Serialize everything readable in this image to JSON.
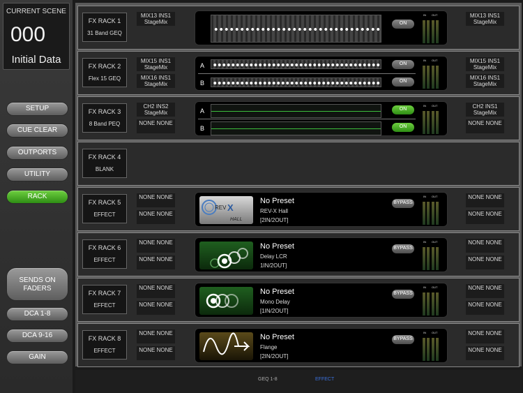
{
  "scene": {
    "label": "CURRENT SCENE",
    "number": "000",
    "name": "Initial Data"
  },
  "sidebar": {
    "setup": "SETUP",
    "cue_clear": "CUE CLEAR",
    "outports": "OUTPORTS",
    "utility": "UTILITY",
    "rack": "RACK",
    "sends_on_faders": "SENDS ON FADERS",
    "dca_1_8": "DCA 1-8",
    "dca_9_16": "DCA 9-16",
    "gain": "GAIN"
  },
  "racks": [
    {
      "name": "FX RACK 1",
      "type": "31 Band GEQ",
      "in_a": "MIX13 INS1 StageMix",
      "out_a": "MIX13 INS1 StageMix",
      "on": "ON",
      "in": "IN",
      "out": "OUT"
    },
    {
      "name": "FX RACK 2",
      "type": "Flex 15 GEQ",
      "in_a": "MIX15 INS1 StageMix",
      "in_b": "MIX16 INS1 StageMix",
      "out_a": "MIX15 INS1 StageMix",
      "out_b": "MIX16 INS1 StageMix",
      "on_a": "ON",
      "on_b": "ON",
      "ch_a": "A",
      "ch_b": "B",
      "in": "IN",
      "out": "OUT"
    },
    {
      "name": "FX RACK 3",
      "type": "8 Band PEQ",
      "in_a": "CH2 INS2 StageMix",
      "in_b": "NONE NONE",
      "out_a": "CH2 INS1 StageMix",
      "out_b": "NONE NONE",
      "on_a": "ON",
      "on_b": "ON",
      "ch_a": "A",
      "ch_b": "B",
      "in": "IN",
      "out": "OUT"
    },
    {
      "name": "FX RACK 4",
      "type": "BLANK"
    },
    {
      "name": "FX RACK 5",
      "type": "EFFECT",
      "in_a": "NONE NONE",
      "in_b": "NONE NONE",
      "out_a": "NONE NONE",
      "out_b": "NONE NONE",
      "preset": "No Preset",
      "effect": "REV-X Hall",
      "io": "[2IN/2OUT]",
      "bypass": "BYPASS",
      "in": "IN",
      "out": "OUT",
      "logo_rev": "REV",
      "logo_x": "X",
      "logo_hall": "HALL"
    },
    {
      "name": "FX RACK 6",
      "type": "EFFECT",
      "in_a": "NONE NONE",
      "in_b": "NONE NONE",
      "out_a": "NONE NONE",
      "out_b": "NONE NONE",
      "preset": "No Preset",
      "effect": "Delay LCR",
      "io": "1IN/2OUT]",
      "bypass": "BYPASS",
      "in": "IN",
      "out": "OUT"
    },
    {
      "name": "FX RACK 7",
      "type": "EFFECT",
      "in_a": "NONE NONE",
      "in_b": "NONE NONE",
      "out_a": "NONE NONE",
      "out_b": "NONE NONE",
      "preset": "No Preset",
      "effect": "Mono Delay",
      "io": "[1IN/2OUT]",
      "bypass": "BYPASS",
      "in": "IN",
      "out": "OUT"
    },
    {
      "name": "FX RACK 8",
      "type": "EFFECT",
      "in_a": "NONE NONE",
      "in_b": "NONE NONE",
      "out_a": "NONE NONE",
      "out_b": "NONE NONE",
      "preset": "No Preset",
      "effect": "Flange",
      "io": "[2IN/2OUT]",
      "bypass": "BYPASS",
      "in": "IN",
      "out": "OUT"
    }
  ],
  "bottom_tabs": {
    "geq": "GEQ 1-8",
    "effect": "EFFECT"
  },
  "colors": {
    "accent_green": "#3fae1f",
    "active_tab": "#3a6fd8",
    "preset_text": "#ffffff"
  }
}
